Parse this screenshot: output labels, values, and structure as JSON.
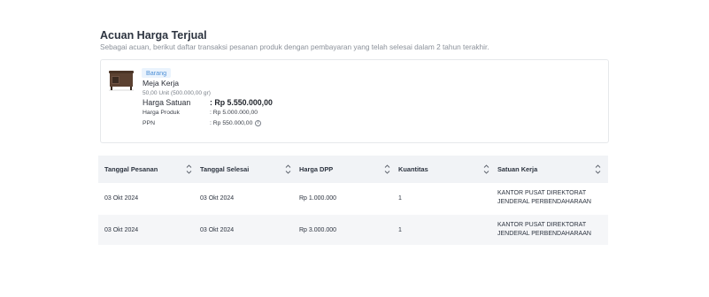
{
  "section": {
    "title": "Acuan Harga Terjual",
    "subtitle": "Sebagai acuan, berikut daftar transaksi pesanan produk dengan pembayaran yang telah selesai dalam 2 tahun terakhir."
  },
  "product": {
    "badge": "Barang",
    "name": "Meja Kerja",
    "quantity": "50,00 Unit (500.000,00 gr)",
    "unit_price_label": "Harga Satuan",
    "unit_price_value": ": Rp 5.550.000,00",
    "product_price_label": "Harga Produk",
    "product_price_value": ": Rp 5.000.000,00",
    "ppn_label": "PPN",
    "ppn_value": ": Rp 550.000,00",
    "info_icon": "info-circle-icon"
  },
  "table": {
    "columns": [
      "Tanggal Pesanan",
      "Tanggal Selesai",
      "Harga DPP",
      "Kuantitas",
      "Satuan Kerja"
    ],
    "sort_icon": "sort-updown-icon",
    "rows": [
      {
        "order_date": "03 Okt 2024",
        "finish_date": "03 Okt 2024",
        "dpp": "Rp 1.000.000",
        "qty": "1",
        "unit_line1": "KANTOR PUSAT DIREKTORAT",
        "unit_line2": "JENDERAL PERBENDAHARAAN"
      },
      {
        "order_date": "03 Okt 2024",
        "finish_date": "03 Okt 2024",
        "dpp": "Rp 3.000.000",
        "qty": "1",
        "unit_line1": "KANTOR PUSAT DIREKTORAT",
        "unit_line2": "JENDERAL PERBENDAHARAAN"
      }
    ]
  }
}
